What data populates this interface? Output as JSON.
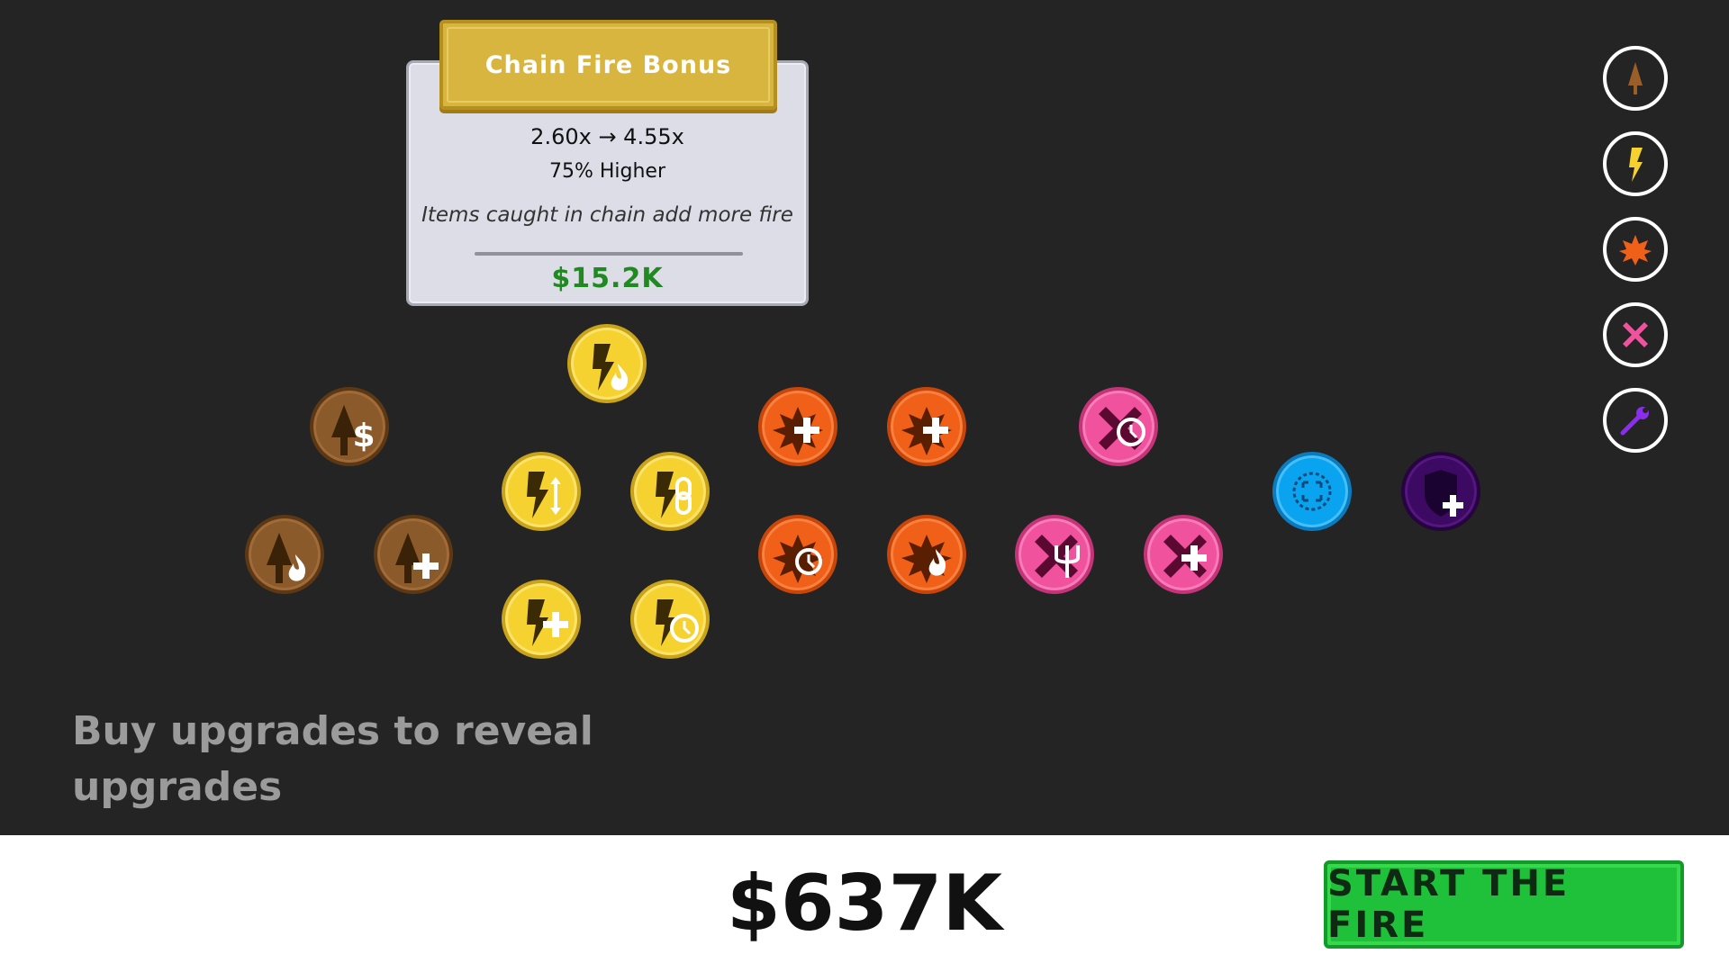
{
  "tooltip": {
    "title": "Chain Fire Bonus",
    "values": "2.60x → 4.55x",
    "percent": "75% Higher",
    "description": "Items caught in chain add more fire",
    "price": "$15.2K"
  },
  "hint": "Buy upgrades to reveal upgrades",
  "money": "$637K",
  "start_button": "START THE FIRE",
  "colors": {
    "wood": "#8a5a2b",
    "lightning": "#f6d231",
    "explosion": "#f06018",
    "cross": "#f0529e",
    "area": "#0aa3ef",
    "shield": "#3d0a63",
    "price_green": "#1f8a1f",
    "start_green": "#1fc13a"
  },
  "categories": [
    "tree-icon",
    "lightning-icon",
    "explosion-icon",
    "cross-icon",
    "wrench-icon"
  ]
}
